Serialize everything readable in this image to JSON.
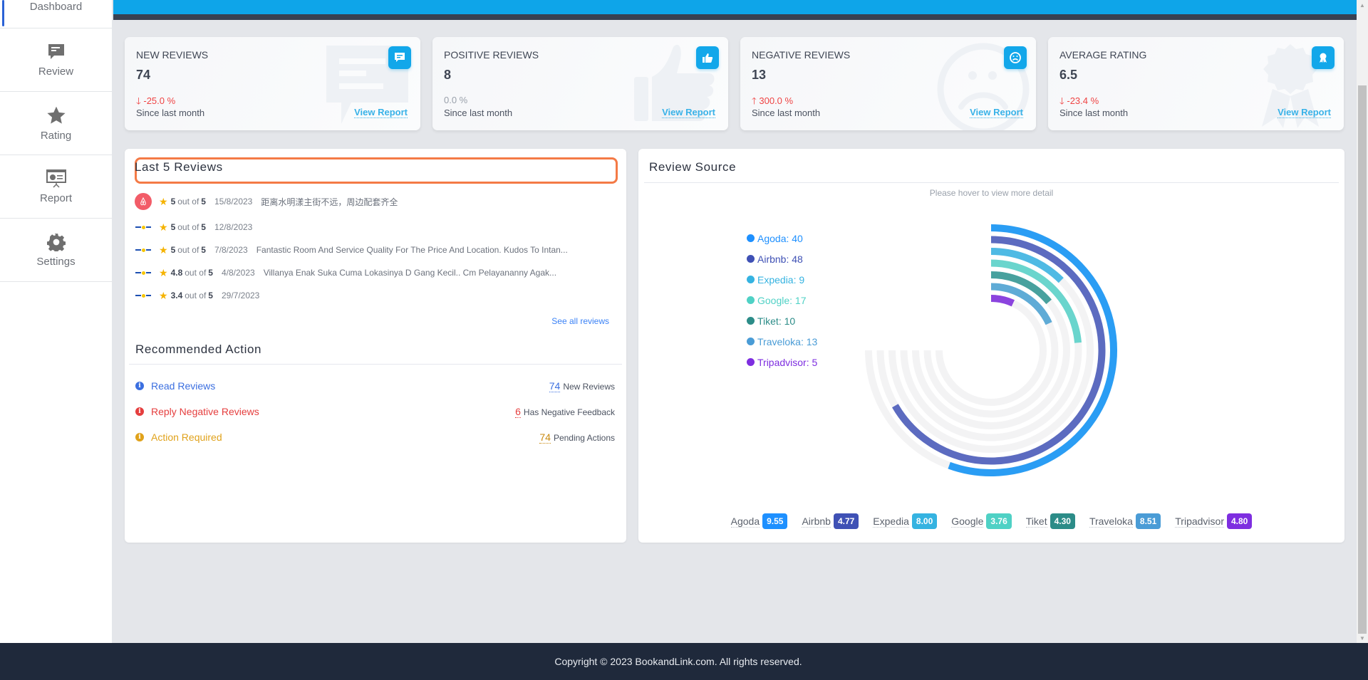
{
  "sidebar": {
    "items": [
      {
        "label": "Dashboard",
        "icon": "dashboard-icon",
        "active": true
      },
      {
        "label": "Review",
        "icon": "comment-icon"
      },
      {
        "label": "Rating",
        "icon": "star-icon"
      },
      {
        "label": "Report",
        "icon": "presentation-icon"
      },
      {
        "label": "Settings",
        "icon": "gear-icon"
      }
    ]
  },
  "stats": [
    {
      "title": "NEW REVIEWS",
      "value": "74",
      "change": "-25.0 %",
      "direction": "down",
      "since": "Since last month",
      "link": "View Report",
      "icon": "comment-icon"
    },
    {
      "title": "POSITIVE REVIEWS",
      "value": "8",
      "change": "0.0 %",
      "direction": "none",
      "since": "Since last month",
      "link": "View Report",
      "icon": "thumbs-up-icon"
    },
    {
      "title": "NEGATIVE REVIEWS",
      "value": "13",
      "change": "300.0 %",
      "direction": "up",
      "since": "Since last month",
      "link": "View Report",
      "icon": "sad-face-icon"
    },
    {
      "title": "AVERAGE RATING",
      "value": "6.5",
      "change": "-23.4 %",
      "direction": "down",
      "since": "Since last month",
      "link": "View Report",
      "icon": "award-icon"
    }
  ],
  "last_reviews": {
    "title": "Last 5 Reviews",
    "out_of_label": "out of",
    "max_score": "5",
    "items": [
      {
        "source": "airbnb",
        "score": "5",
        "date": "15/8/2023",
        "text": "距离水明漾主街不远，周边配套齐全"
      },
      {
        "source": "tiket",
        "score": "5",
        "date": "12/8/2023",
        "text": ""
      },
      {
        "source": "tiket",
        "score": "5",
        "date": "7/8/2023",
        "text": "Fantastic Room And Service Quality For The Price And Location. Kudos To Intan..."
      },
      {
        "source": "tiket",
        "score": "4.8",
        "date": "4/8/2023",
        "text": "Villanya Enak Suka Cuma Lokasinya D Gang Kecil.. Cm Pelayananny Agak..."
      },
      {
        "source": "tiket",
        "score": "3.4",
        "date": "29/7/2023",
        "text": ""
      }
    ],
    "see_all": "See all reviews"
  },
  "recommended": {
    "title": "Recommended Action",
    "actions": [
      {
        "label": "Read Reviews",
        "count": "74",
        "suffix": "New Reviews",
        "color": "#3b6fe0"
      },
      {
        "label": "Reply Negative Reviews",
        "count": "6",
        "suffix": "Has Negative Feedback",
        "color": "#e53e3e"
      },
      {
        "label": "Action Required",
        "count": "74",
        "suffix": "Pending Actions",
        "color": "#e0a21b"
      }
    ]
  },
  "review_source": {
    "title": "Review Source",
    "hint": "Please hover to view more detail"
  },
  "chart_data": {
    "type": "radialBar",
    "title": "Review Source",
    "categories": [
      "Agoda",
      "Airbnb",
      "Expedia",
      "Google",
      "Tiket",
      "Traveloka",
      "Tripadvisor"
    ],
    "values": [
      40,
      48,
      9,
      17,
      10,
      13,
      5
    ],
    "max": 54,
    "sweep_degrees": 270,
    "colors": [
      "#2a9df4",
      "#5c6bc0",
      "#4fbae4",
      "#6ad5cd",
      "#48a19e",
      "#5fabd6",
      "#8b44de"
    ],
    "legend_colors": [
      "#1e90ff",
      "#3f51b5",
      "#35b3e1",
      "#4fd1c5",
      "#2c8c88",
      "#4a9cd6",
      "#7e2ee0"
    ],
    "legend_position": "left"
  },
  "ratings": [
    {
      "name": "Agoda",
      "value": "9.55",
      "color": "#1e90ff"
    },
    {
      "name": "Airbnb",
      "value": "4.77",
      "color": "#3f51b5"
    },
    {
      "name": "Expedia",
      "value": "8.00",
      "color": "#35b3e1"
    },
    {
      "name": "Google",
      "value": "3.76",
      "color": "#4fd1c5"
    },
    {
      "name": "Tiket",
      "value": "4.30",
      "color": "#2c8c88"
    },
    {
      "name": "Traveloka",
      "value": "8.51",
      "color": "#4a9cd6"
    },
    {
      "name": "Tripadvisor",
      "value": "4.80",
      "color": "#7e2ee0"
    }
  ],
  "footer": {
    "text": "Copyright © 2023 BookandLink.com. All rights reserved."
  }
}
